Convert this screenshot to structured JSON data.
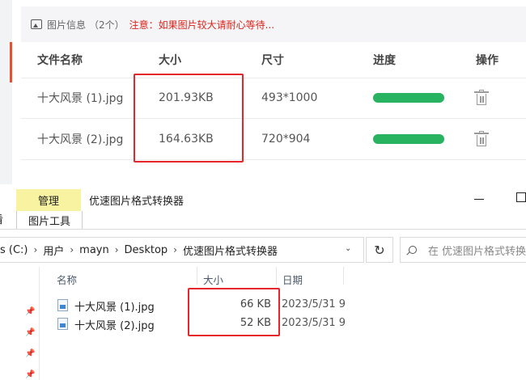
{
  "upload_panel": {
    "info_label": "图片信息",
    "count": "（2个）",
    "warning": "注意：如果图片较大请耐心等待...",
    "columns": [
      "文件名称",
      "大小",
      "尺寸",
      "进度",
      "操作"
    ],
    "rows": [
      {
        "name": "十大风景 (1).jpg",
        "size": "201.93KB",
        "dimensions": "493*1000",
        "progress": 1.0
      },
      {
        "name": "十大风景 (2).jpg",
        "size": "164.63KB",
        "dimensions": "720*904",
        "progress": 1.0
      }
    ],
    "progress_color": "#27b35f",
    "warning_color": "#d9251c"
  },
  "explorer": {
    "ribbon": {
      "manage_tab": "管理",
      "tools_tab": "图片工具",
      "left_fragment": "看",
      "highlight_color": "#f7f3a0"
    },
    "window_title": "优速图片格式转换器",
    "address": {
      "drive": "s (C:)",
      "segments": [
        "用户",
        "mayn",
        "Desktop",
        "优速图片格式转换器"
      ],
      "separator": "›"
    },
    "search_placeholder": "在 优速图片格式转换",
    "columns": {
      "name": "名称",
      "size": "大小",
      "date": "日期"
    },
    "files": [
      {
        "name": "十大风景 (1).jpg",
        "size": "66 KB",
        "date": "2023/5/31 9"
      },
      {
        "name": "十大风景 (2).jpg",
        "size": "52 KB",
        "date": "2023/5/31 9"
      }
    ]
  },
  "highlight_color": "#e5262a"
}
